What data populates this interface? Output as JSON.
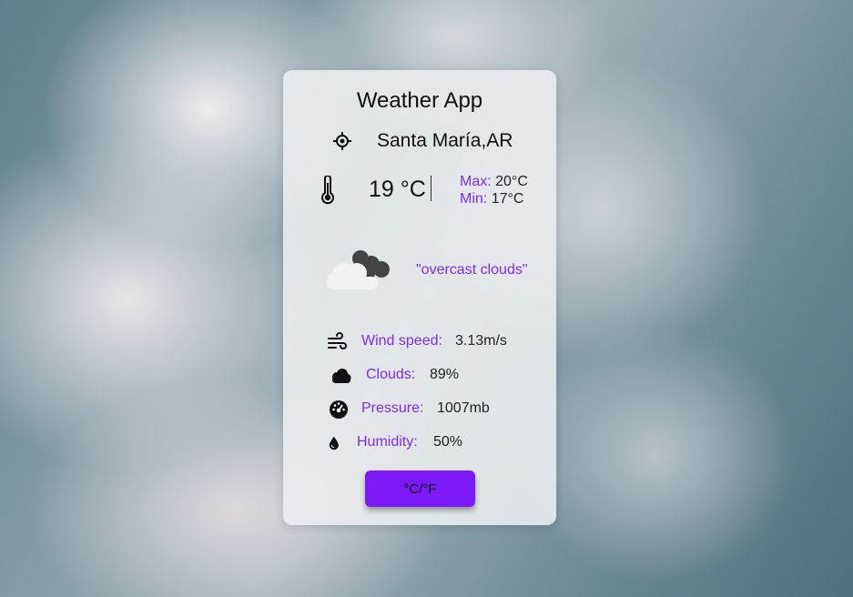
{
  "app": {
    "title": "Weather App"
  },
  "location": {
    "name": "Santa María,AR",
    "icon": "crosshair-location-icon"
  },
  "temperature": {
    "current": "19 °C",
    "max_label": "Max:",
    "max_value": "20°C",
    "min_label": "Min:",
    "min_value": "17°C",
    "icon": "thermometer-icon"
  },
  "condition": {
    "description": "\"overcast clouds\"",
    "icon": "overcast-clouds-icon"
  },
  "stats": [
    {
      "label": "Wind speed:",
      "value": "3.13m/s",
      "icon": "wind-icon"
    },
    {
      "label": "Clouds:",
      "value": "89%",
      "icon": "cloud-icon"
    },
    {
      "label": "Pressure:",
      "value": "1007mb",
      "icon": "gauge-icon"
    },
    {
      "label": "Humidity:",
      "value": "50%",
      "icon": "droplet-icon"
    }
  ],
  "unit_toggle": {
    "label": "°C/°F"
  },
  "colors": {
    "accent": "#7b2df0",
    "button": "#7b19f7",
    "card": "#eceef0"
  }
}
